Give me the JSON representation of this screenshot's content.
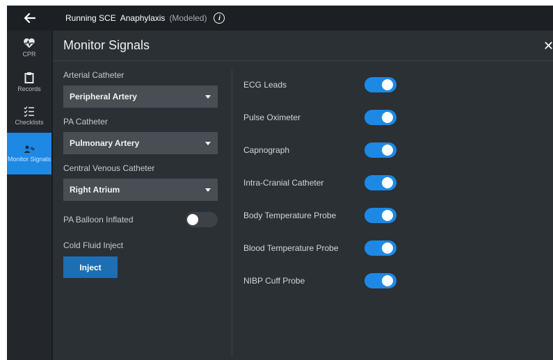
{
  "topbar": {
    "back_icon": "arrow-left-icon",
    "title_prefix": "Running SCE",
    "scenario": "Anaphylaxis",
    "scenario_mode": "(Modeled)",
    "info_icon": "info-icon",
    "info_glyph": "i"
  },
  "sidebar": {
    "items": [
      {
        "label": "CPR",
        "icon": "heart-pulse-icon"
      },
      {
        "label": "Records",
        "icon": "clipboard-icon"
      },
      {
        "label": "Checklists",
        "icon": "checklist-icon"
      },
      {
        "label": "Monitor Signals",
        "icon": "person-signal-icon",
        "active": true
      }
    ]
  },
  "panel": {
    "title": "Monitor Signals",
    "close_icon": "close-icon",
    "close_glyph": "✕"
  },
  "catheters": [
    {
      "label": "Arterial Catheter",
      "value": "Peripheral Artery"
    },
    {
      "label": "PA Catheter",
      "value": "Pulmonary Artery"
    },
    {
      "label": "Central Venous Catheter",
      "value": "Right Atrium"
    }
  ],
  "balloon": {
    "label": "PA Balloon Inflated",
    "on": false
  },
  "cold_fluid": {
    "label": "Cold Fluid Inject",
    "button": "Inject"
  },
  "signals": [
    {
      "label": "ECG Leads",
      "on": true
    },
    {
      "label": "Pulse Oximeter",
      "on": true
    },
    {
      "label": "Capnograph",
      "on": true
    },
    {
      "label": "Intra-Cranial Catheter",
      "on": true
    },
    {
      "label": "Body Temperature Probe",
      "on": true
    },
    {
      "label": "Blood Temperature Probe",
      "on": true
    },
    {
      "label": "NIBP Cuff Probe",
      "on": true
    }
  ],
  "colors": {
    "accent": "#1e88e5",
    "background": "#2b3034",
    "topbar": "#1c2024",
    "control": "#484e53"
  }
}
